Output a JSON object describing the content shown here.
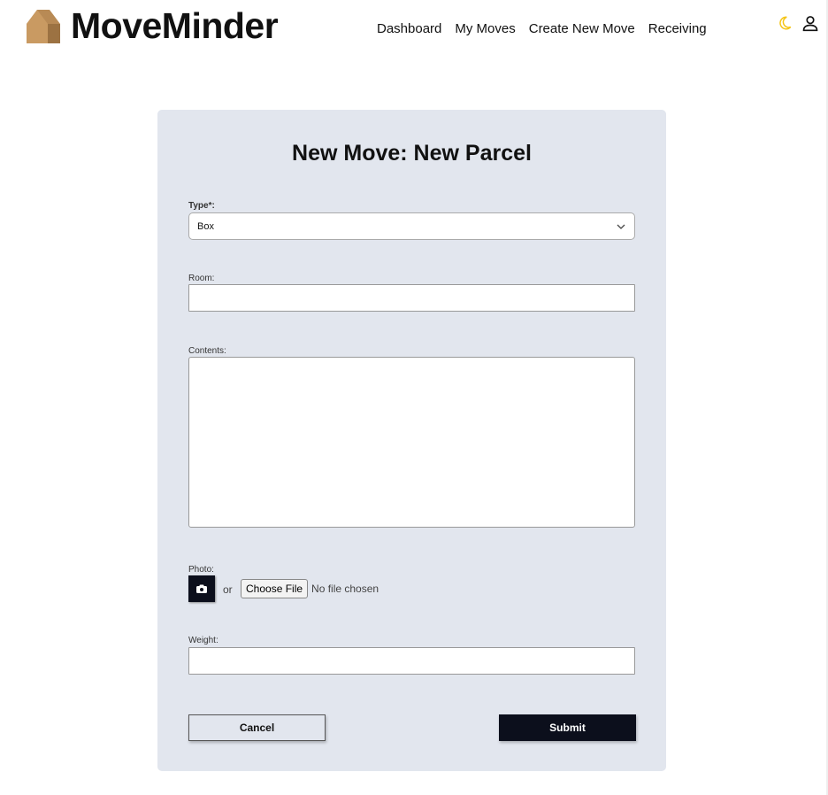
{
  "app": {
    "name": "MoveMinder"
  },
  "nav": {
    "items": [
      "Dashboard",
      "My Moves",
      "Create New Move",
      "Receiving"
    ]
  },
  "icons": {
    "theme": "moon-icon",
    "account": "user-icon",
    "theme_color": "#f5c518"
  },
  "form": {
    "title": "New Move: New Parcel",
    "type_label": "Type*:",
    "type_value": "Box",
    "room_label": "Room:",
    "room_value": "",
    "contents_label": "Contents:",
    "contents_value": "",
    "photo_label": "Photo:",
    "or": "or",
    "choose_file": "Choose File",
    "no_file": "No file chosen",
    "weight_label": "Weight:",
    "weight_value": "",
    "cancel": "Cancel",
    "submit": "Submit"
  }
}
